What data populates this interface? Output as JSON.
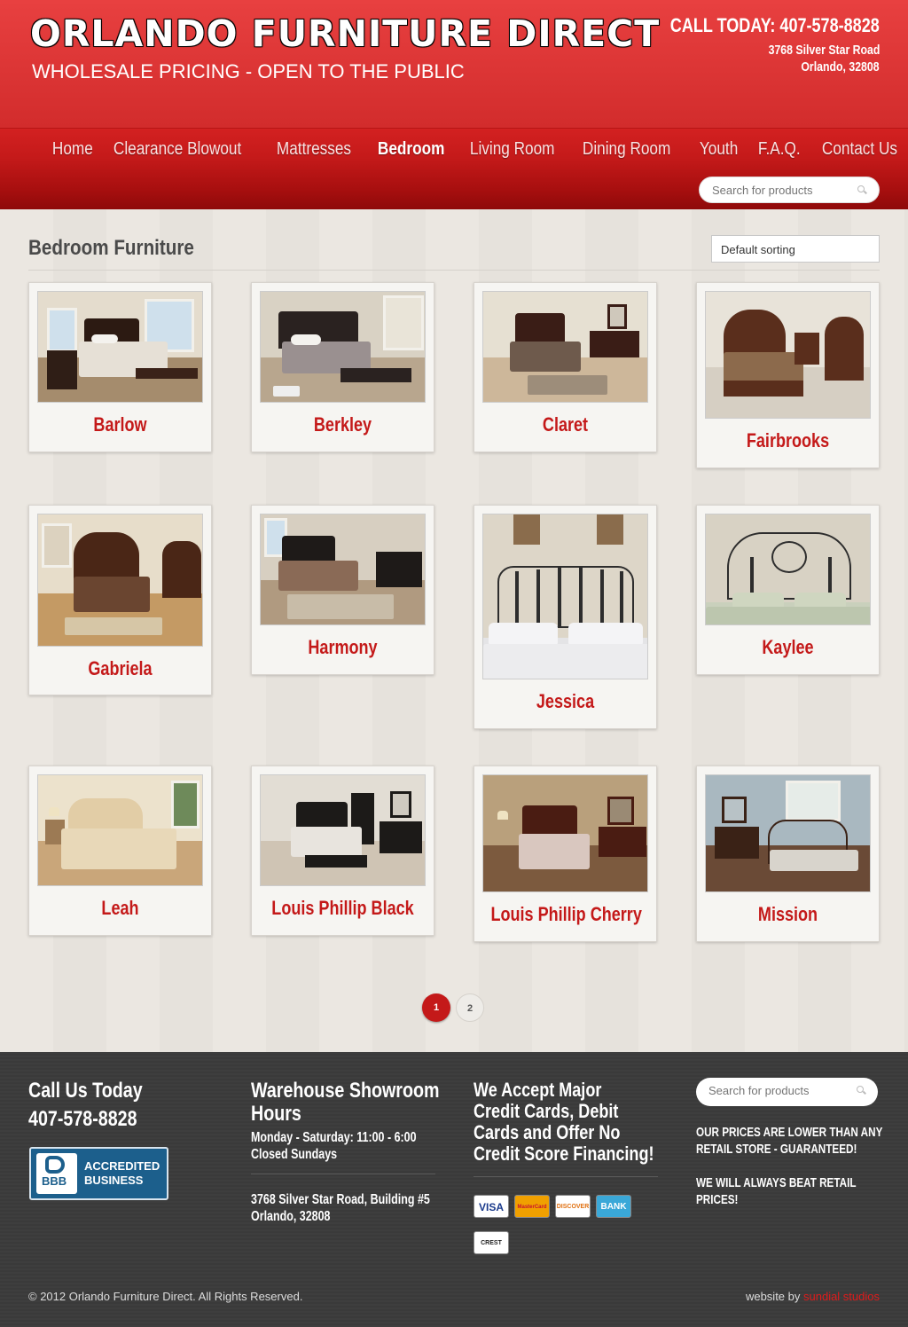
{
  "header": {
    "title": "ORLANDO FURNITURE DIRECT",
    "tagline": "WHOLESALE PRICING - OPEN TO THE PUBLIC",
    "call": "CALL TODAY: 407-578-8828",
    "address_line1": "3768 Silver Star Road",
    "address_line2": "Orlando, 32808"
  },
  "nav": {
    "items": [
      "Home",
      "Clearance Blowout",
      "Mattresses",
      "Bedroom",
      "Living Room",
      "Dining Room",
      "Youth",
      "F.A.Q.",
      "Contact Us"
    ],
    "active": "Bedroom",
    "search_placeholder": "Search for products"
  },
  "main": {
    "title": "Bedroom Furniture",
    "sort_selected": "Default sorting",
    "products": [
      "Barlow",
      "Berkley",
      "Claret",
      "Fairbrooks",
      "Gabriela",
      "Harmony",
      "Jessica",
      "Kaylee",
      "Leah",
      "Louis Phillip Black",
      "Louis Phillip Cherry",
      "Mission"
    ],
    "pagination": [
      "1",
      "2"
    ],
    "current_page": "1"
  },
  "footer": {
    "call_heading": "Call Us Today",
    "call_number": "407-578-8828",
    "bbb_text": [
      "ACCREDITED",
      "BUSINESS"
    ],
    "bbb_mark": "BBB",
    "hours_heading_1": "Warehouse Showroom",
    "hours_heading_2": "Hours",
    "hours_line1": "Monday - Saturday: 11:00 - 6:00",
    "hours_line2": "Closed Sundays",
    "address_line1": "3768 Silver Star Road, Building #5",
    "address_line2": "Orlando, 32808",
    "credit_heading": [
      "We Accept Major",
      "Credit Cards, Debit",
      "Cards and Offer No",
      "Credit Score Financing!"
    ],
    "card_logos": [
      "VISA",
      "MasterCard",
      "DISCOVER",
      "BANK",
      "CREST"
    ],
    "search_placeholder": "Search for products",
    "guarantee_1": [
      "OUR PRICES ARE LOWER THAN ANY",
      "RETAIL STORE - GUARANTEED!"
    ],
    "guarantee_2": [
      "WE WILL ALWAYS BEAT RETAIL",
      "PRICES!"
    ],
    "copyright": "© 2012 Orlando Furniture Direct. All Rights Reserved.",
    "credit_prefix": "website by",
    "credit_link": "sundial studios"
  },
  "colors": {
    "brand_red": "#c41919",
    "header_red": "#d22c2c",
    "footer_bg": "#3c3c3c"
  }
}
